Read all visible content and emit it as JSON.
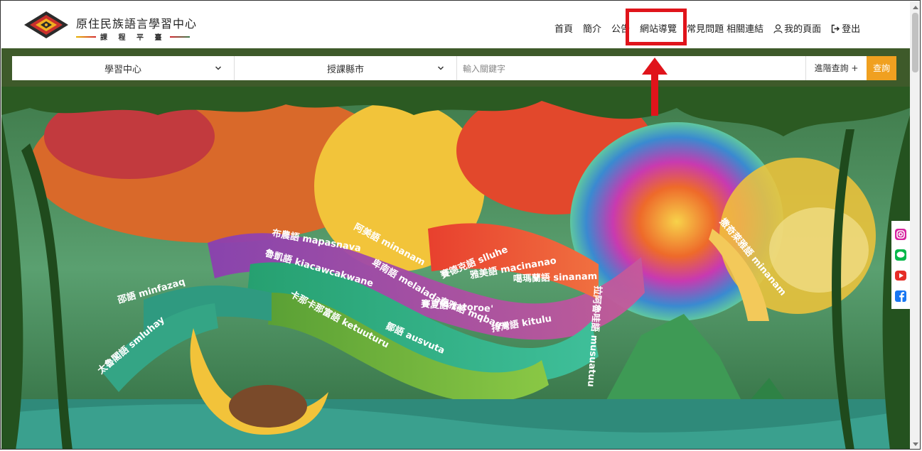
{
  "brand": {
    "title": "原住民族語言學習中心",
    "subtitle": "課 程 平 臺"
  },
  "nav": {
    "items": [
      "首頁",
      "簡介",
      "公告",
      "網站導覽",
      "常見問題",
      "相關連結"
    ],
    "my_page": "我的頁面",
    "logout": "登出"
  },
  "search": {
    "center_select": "學習中心",
    "city_select": "授課縣市",
    "keyword_placeholder": "輸入關鍵字",
    "advanced": "進階查詢 +",
    "submit": "查詢"
  },
  "hero_ribbons": [
    "布農語 mapasnava",
    "阿美語 minanam",
    "卑南語 melaladam",
    "泰雅語 mqbaq",
    "排灣語 kitulu",
    "魯凱語 kiacawcakwane",
    "鄒語 ausvuta",
    "賽夏語 tatoroe'",
    "卡那卡那富語 ketuuturu",
    "賽德克語 slluhe",
    "雅美語 macinanao",
    "噶瑪蘭語 sinanam",
    "邵語 minfazaq",
    "太魯閣語 smluhay",
    "拉阿魯哇語 musuatuu",
    "撒奇萊雅語 minanam"
  ],
  "social": [
    "instagram-icon",
    "line-icon",
    "youtube-icon",
    "facebook-icon"
  ],
  "colors": {
    "accent": "#f0a020",
    "highlight": "#e0141b",
    "band": "#3e5a2a"
  }
}
